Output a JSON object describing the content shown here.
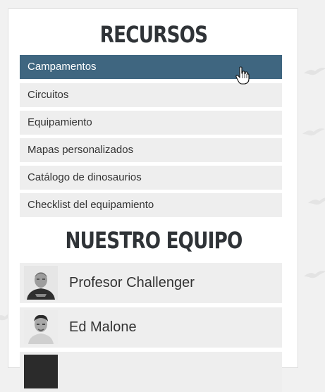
{
  "resources": {
    "title": "RECURSOS",
    "items": [
      {
        "label": "Campamentos",
        "active": true
      },
      {
        "label": "Circuitos",
        "active": false
      },
      {
        "label": "Equipamiento",
        "active": false
      },
      {
        "label": "Mapas personalizados",
        "active": false
      },
      {
        "label": "Catálogo de dinosaurios",
        "active": false
      },
      {
        "label": "Checklist del equipamiento",
        "active": false
      }
    ]
  },
  "team": {
    "title": "NUESTRO EQUIPO",
    "members": [
      {
        "name": "Profesor Challenger"
      },
      {
        "name": "Ed Malone"
      }
    ]
  },
  "colors": {
    "active_bg": "#3f6680",
    "item_bg": "#eeeeee",
    "title_color": "#2f3337",
    "page_bg": "#f1f1f1"
  },
  "icons": {
    "cursor": "hand-pointer-icon",
    "background": "bird-silhouette-icon"
  }
}
